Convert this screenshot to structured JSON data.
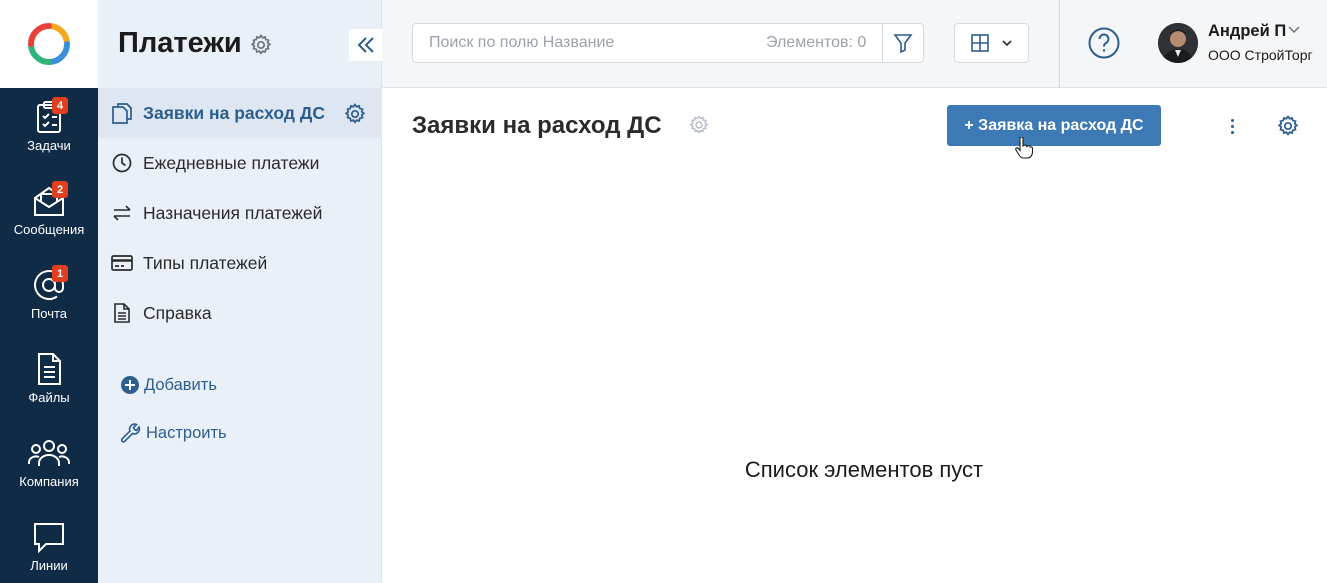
{
  "rail": {
    "items": [
      {
        "label": "Задачи",
        "badge": "4",
        "icon": "tasks-icon"
      },
      {
        "label": "Сообщения",
        "badge": "2",
        "icon": "messages-icon"
      },
      {
        "label": "Почта",
        "badge": "1",
        "icon": "mail-at-icon"
      },
      {
        "label": "Файлы",
        "icon": "files-icon"
      },
      {
        "label": "Компания",
        "icon": "company-icon"
      },
      {
        "label": "Линии",
        "icon": "lines-chat-icon"
      }
    ]
  },
  "sidebar": {
    "title": "Платежи",
    "items": [
      {
        "label": "Заявки на расход ДС",
        "icon": "copy-icon",
        "active": true
      },
      {
        "label": "Ежедневные платежи",
        "icon": "clock-icon"
      },
      {
        "label": "Назначения платежей",
        "icon": "swap-arrows-icon"
      },
      {
        "label": "Типы платежей",
        "icon": "card-icon"
      },
      {
        "label": "Справка",
        "icon": "document-icon"
      }
    ],
    "add_label": "Добавить",
    "configure_label": "Настроить"
  },
  "topbar": {
    "search_placeholder": "Поиск по полю Название",
    "elements_count": "Элементов: 0",
    "user_name": "Андрей П",
    "user_company": "ООО СтройТорг"
  },
  "main": {
    "title": "Заявки на расход ДС",
    "create_button": "+ Заявка на расход ДС",
    "empty_message": "Список элементов пуст"
  },
  "colors": {
    "rail_bg": "#0f2b46",
    "sidebar_bg": "#eaf0f7",
    "accent": "#2c5e8f",
    "primary_button": "#3d7ab5",
    "badge": "#e0401f"
  }
}
